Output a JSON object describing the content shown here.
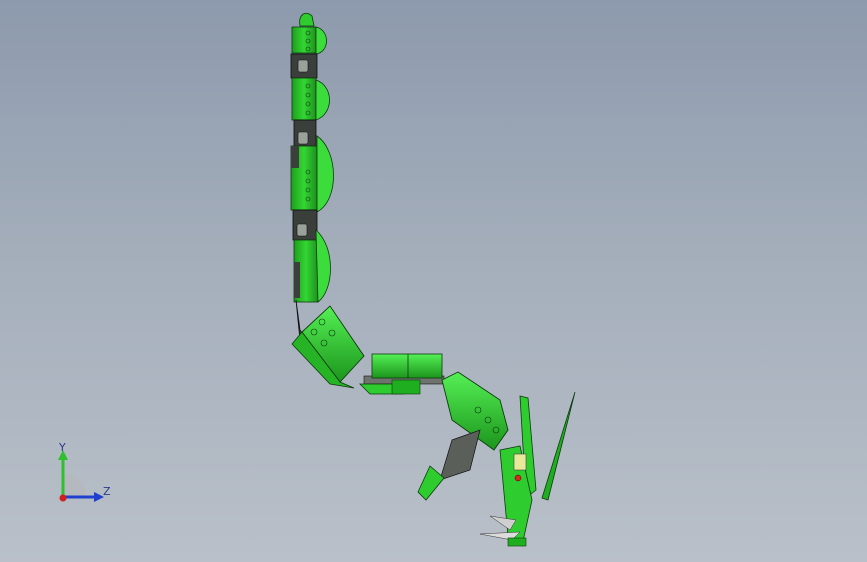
{
  "viewport": {
    "background_top": "#8d9aad",
    "background_bottom": "#b9c0c9"
  },
  "model": {
    "part_color_main": "#2ecc2e",
    "part_color_dark": "#1e9e1e",
    "part_color_light": "#4ef04e",
    "joint_color": "#4b4f4b",
    "joint_color_light": "#8a8f8a",
    "edge_color": "#0d3a0d"
  },
  "triad": {
    "y_label": "Y",
    "z_label": "Z",
    "y_color": "#2ec02e",
    "z_color": "#1f3fd0",
    "x_color": "#d01f1f"
  }
}
